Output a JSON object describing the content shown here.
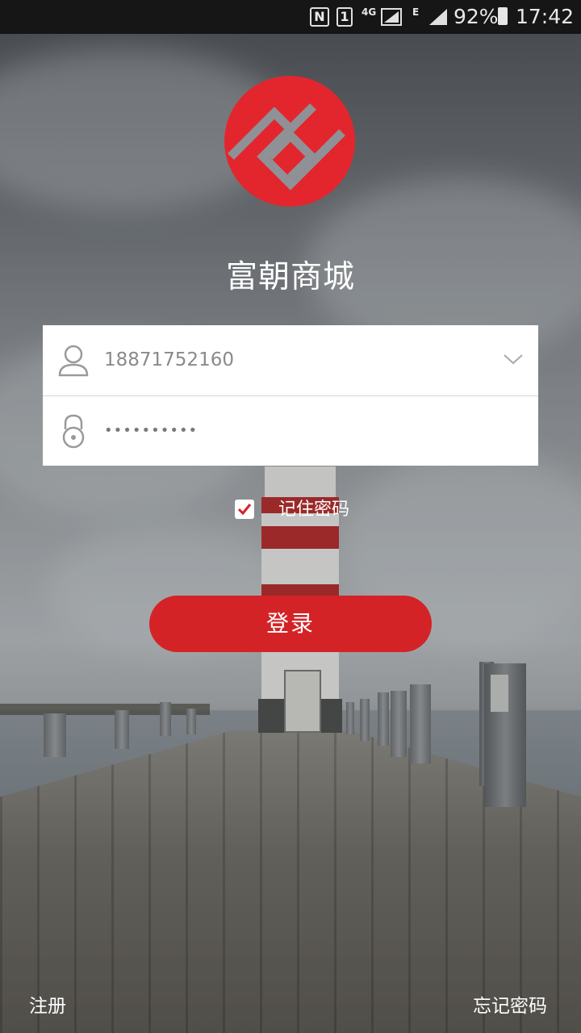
{
  "status_bar": {
    "nfc": "N",
    "sim_slot": "1",
    "network_4g": "4G",
    "network_e": "E",
    "battery": "92%",
    "time": "17:42"
  },
  "app": {
    "title": "富朝商城",
    "brand_color": "#d42326",
    "logo": "fuchao-logo-icon"
  },
  "login_form": {
    "username_value": "18871752160",
    "password_value": "••••••••••",
    "remember_checked": true,
    "remember_label": "记住密码",
    "login_button": "登录"
  },
  "footer": {
    "register": "注册",
    "forgot_password": "忘记密码"
  }
}
